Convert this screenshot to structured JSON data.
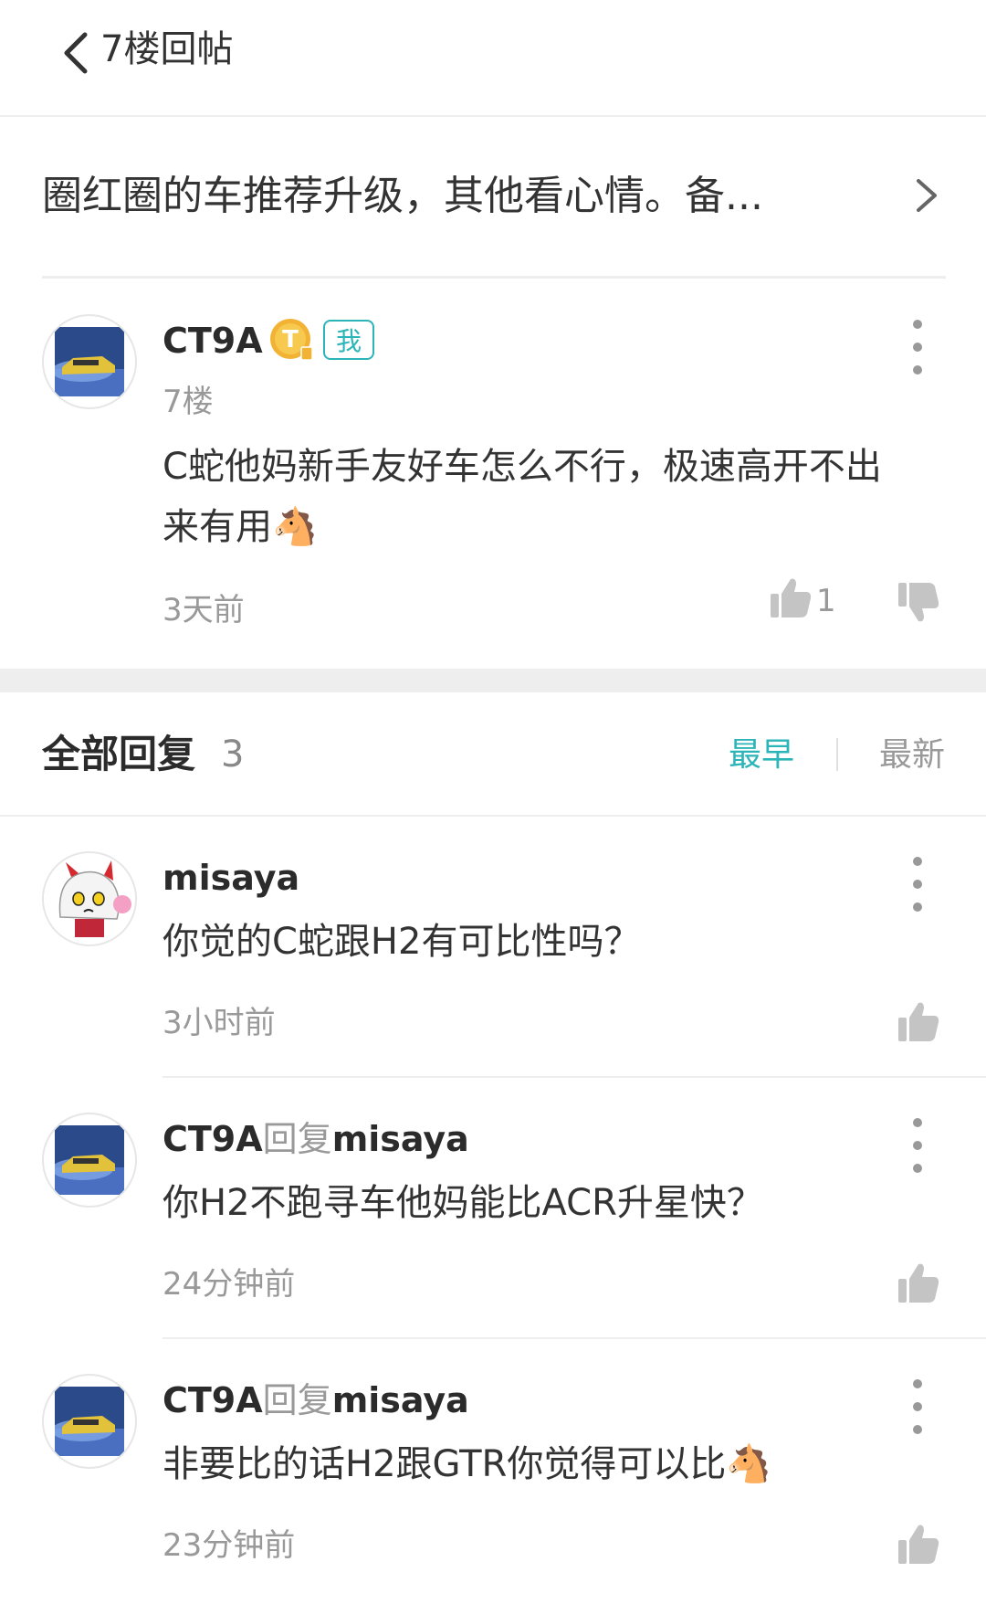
{
  "header": {
    "title": "7楼回帖"
  },
  "post": {
    "title": "圈红圈的车推荐升级，其他看心情。备..."
  },
  "floor_post": {
    "username": "CT9A",
    "level_badge": "T",
    "me_tag": "我",
    "floor": "7楼",
    "content_line1": "C蛇他妈新手友好车怎么不行，极速高开不出",
    "content_line2": "来有用",
    "emoji": "🐴",
    "time": "3天前",
    "like_count": "1"
  },
  "replies_section": {
    "title": "全部回复",
    "count": "3",
    "sort_earliest": "最早",
    "sort_latest": "最新"
  },
  "replies": [
    {
      "username": "misaya",
      "reply_word": "",
      "reply_target": "",
      "content": "你觉的C蛇跟H2有可比性吗？",
      "time": "3小时前"
    },
    {
      "username": "CT9A",
      "reply_word": "回复",
      "reply_target": "misaya",
      "content": "你H2不跑寻车他妈能比ACR升星快？",
      "time": "24分钟前"
    },
    {
      "username": "CT9A",
      "reply_word": "回复",
      "reply_target": "misaya",
      "content": "非要比的话H2跟GTR你觉得可以比",
      "emoji": "🐴",
      "time": "23分钟前"
    }
  ],
  "colors": {
    "accent": "#2bb5b8",
    "muted": "#999999",
    "gold": "#f2b233"
  }
}
